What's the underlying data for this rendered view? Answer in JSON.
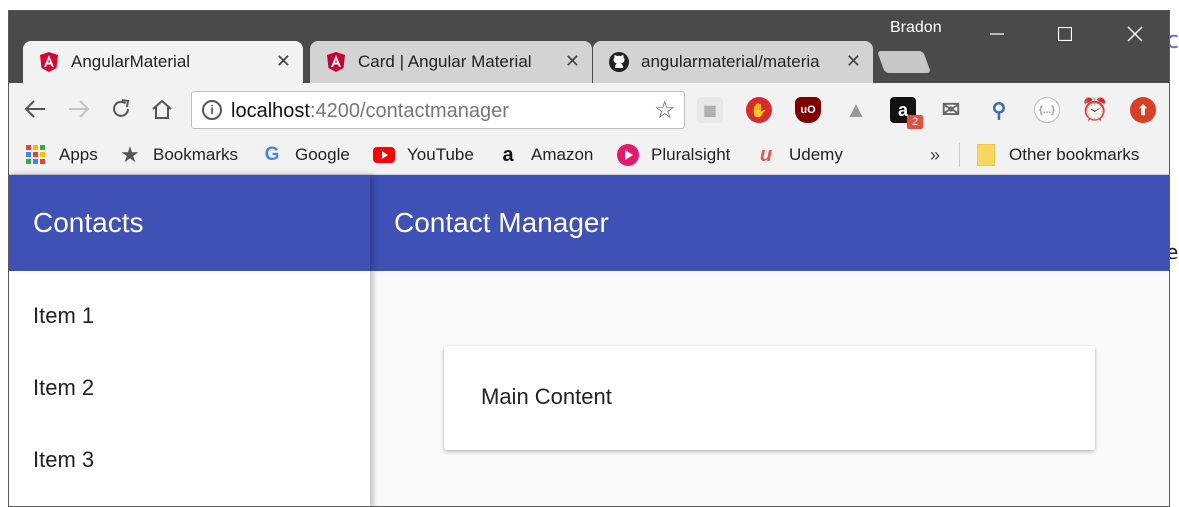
{
  "browser": {
    "profile_name": "Bradon",
    "tabs": [
      {
        "title": "AngularMaterial",
        "active": true,
        "icon": "angular-icon"
      },
      {
        "title": "Card | Angular Material",
        "active": false,
        "icon": "angular-icon"
      },
      {
        "title": "angularmaterial/materia",
        "active": false,
        "icon": "github-icon"
      }
    ],
    "address": {
      "host": "localhost",
      "path": ":4200/contactmanager"
    },
    "bookmarks": [
      {
        "label": "Apps",
        "icon": "apps-grid-icon"
      },
      {
        "label": "Bookmarks",
        "icon": "star-icon"
      },
      {
        "label": "Google",
        "icon": "google-icon"
      },
      {
        "label": "YouTube",
        "icon": "youtube-icon"
      },
      {
        "label": "Amazon",
        "icon": "amazon-icon"
      },
      {
        "label": "Pluralsight",
        "icon": "pluralsight-icon"
      },
      {
        "label": "Udemy",
        "icon": "udemy-icon"
      }
    ],
    "overflow_label": "»",
    "other_bookmarks": "Other bookmarks",
    "extension_badge": "2",
    "colors": {
      "titlebar": "#4a4a4a",
      "toolbar": "#f2f2f2",
      "primary": "#3f51b5"
    }
  },
  "app": {
    "sidenav_title": "Contacts",
    "nav_items": [
      "Item 1",
      "Item 2",
      "Item 3"
    ],
    "toolbar_title": "Contact Manager",
    "card_text": "Main Content"
  }
}
